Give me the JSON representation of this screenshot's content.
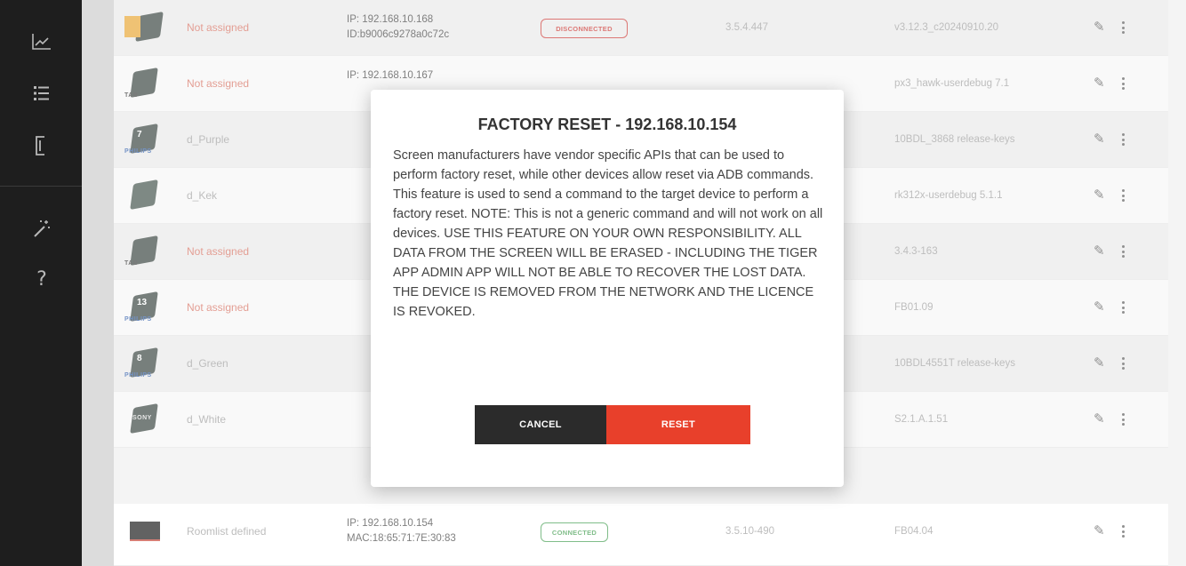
{
  "sidebar": {
    "icons": [
      "chart-icon",
      "list-icon",
      "bracket-icon",
      "magic-wand-icon",
      "help-icon"
    ],
    "help_label": "?"
  },
  "rows": [
    {
      "icon": "tile-badge",
      "name": "Not assigned",
      "name_color": "red",
      "ip": "IP: 192.168.10.168",
      "id": "ID:b9006c9278a0c72c",
      "status": "DISCONNECTED",
      "version": "3.5.4.447",
      "firmware": "v3.12.3_c20240910.20"
    },
    {
      "icon": "tile",
      "brand": "TAB",
      "name": "Not assigned",
      "name_color": "red",
      "ip": "IP: 192.168.10.167",
      "id": "",
      "status": "",
      "version": "",
      "firmware": "px3_hawk-userdebug 7.1"
    },
    {
      "icon": "tile-num",
      "num": "7",
      "brand": "PHILIPS",
      "name": "d_Purple",
      "name_color": "grey",
      "ip": "",
      "id": "",
      "status": "",
      "version": "",
      "firmware": "10BDL_3868 release-keys"
    },
    {
      "icon": "tile-green",
      "name": "d_Kek",
      "name_color": "grey",
      "ip": "",
      "id": "",
      "status": "",
      "version": "",
      "firmware": "rk312x-userdebug 5.1.1"
    },
    {
      "icon": "tile",
      "brand": "TAB",
      "name": "Not assigned",
      "name_color": "red",
      "ip": "",
      "id": "",
      "status": "",
      "version": "",
      "firmware": "3.4.3-163"
    },
    {
      "icon": "tile-num",
      "num": "13",
      "brand": "PHILIPS",
      "name": "Not assigned",
      "name_color": "red",
      "ip": "",
      "id": "",
      "status": "",
      "version": "",
      "firmware": "FB01.09"
    },
    {
      "icon": "tile-num",
      "num": "8",
      "brand": "PHILIPS",
      "name": "d_Green",
      "name_color": "grey",
      "ip": "",
      "id": "",
      "status": "",
      "version": "",
      "firmware": "10BDL4551T release-keys"
    },
    {
      "icon": "tile",
      "brand": "SONY",
      "name": "d_White",
      "name_color": "grey",
      "ip": "",
      "id": "",
      "status": "",
      "version": "",
      "firmware": "S2.1.A.1.51"
    },
    {
      "icon": "monitor",
      "name": "Roomlist defined",
      "name_color": "grey",
      "ip": "IP: 192.168.10.154",
      "id": "MAC:18:65:71:7E:30:83",
      "status": "CONNECTED",
      "version": "3.5.10-490",
      "firmware": "FB04.04"
    }
  ],
  "modal": {
    "title": "FACTORY RESET - 192.168.10.154",
    "body": "Screen manufacturers have vendor specific APIs that can be used to perform factory reset, while other devices allow reset via ADB commands. This feature is used to send a command to the target device to perform a factory reset. NOTE: This is not a generic command and will not work on all devices. USE THIS FEATURE ON YOUR OWN RESPONSIBILITY. ALL DATA FROM THE SCREEN WILL BE ERASED - INCLUDING THE TIGER APP ADMIN APP WILL NOT BE ABLE TO RECOVER THE LOST DATA. THE DEVICE IS REMOVED FROM THE NETWORK AND THE LICENCE IS REVOKED.",
    "cancel_label": "CANCEL",
    "reset_label": "RESET"
  },
  "colors": {
    "sidebar_bg": "#1e1e1e",
    "reset_btn": "#e8402b",
    "cancel_btn": "#2b2b2b",
    "disconnected": "#c9302c",
    "connected": "#3c9a4a",
    "not_assigned": "#d56a5a"
  }
}
